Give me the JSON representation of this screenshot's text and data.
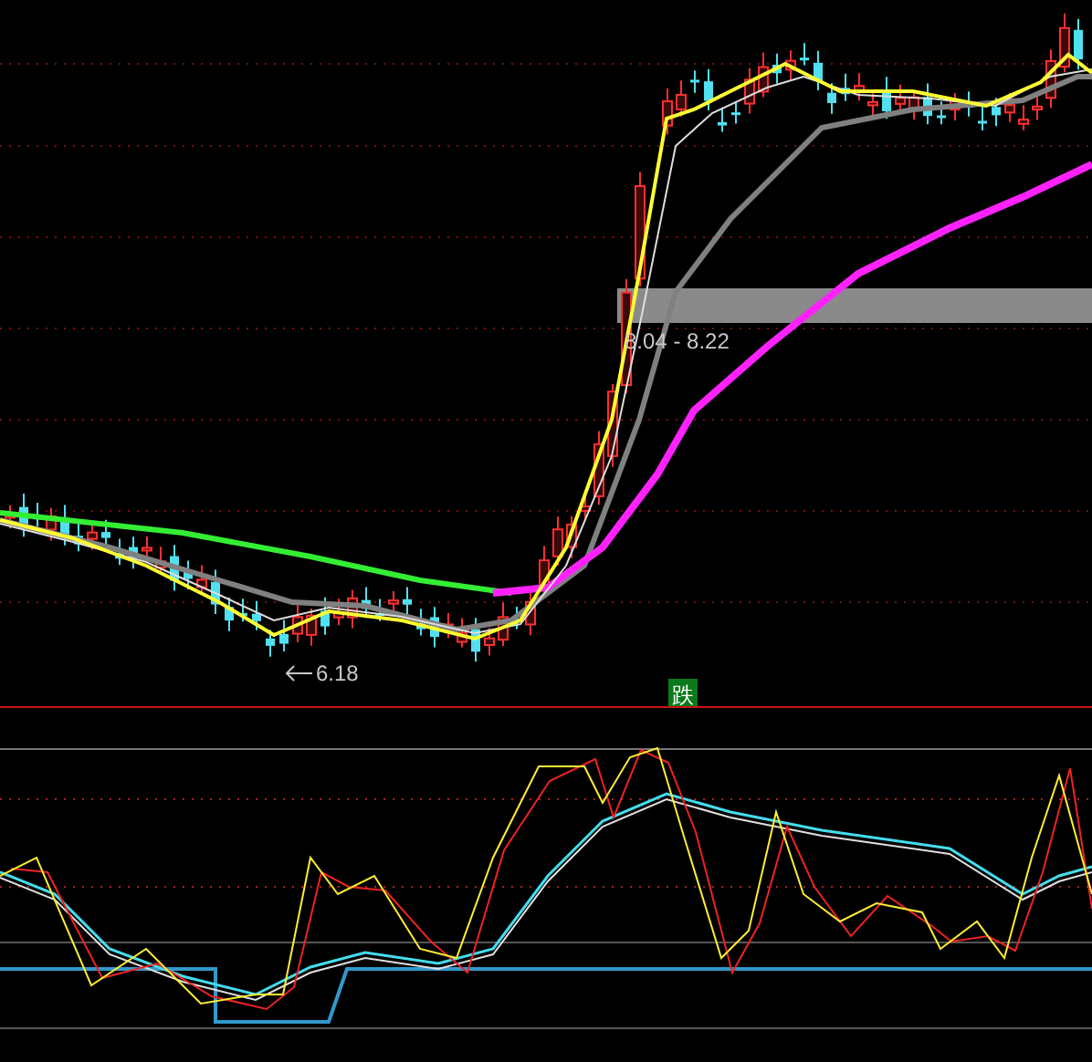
{
  "price_panel": {
    "range_label": "8.04 - 8.22",
    "low_label": "6.18"
  },
  "signal_badge": {
    "text": "跌"
  }
}
